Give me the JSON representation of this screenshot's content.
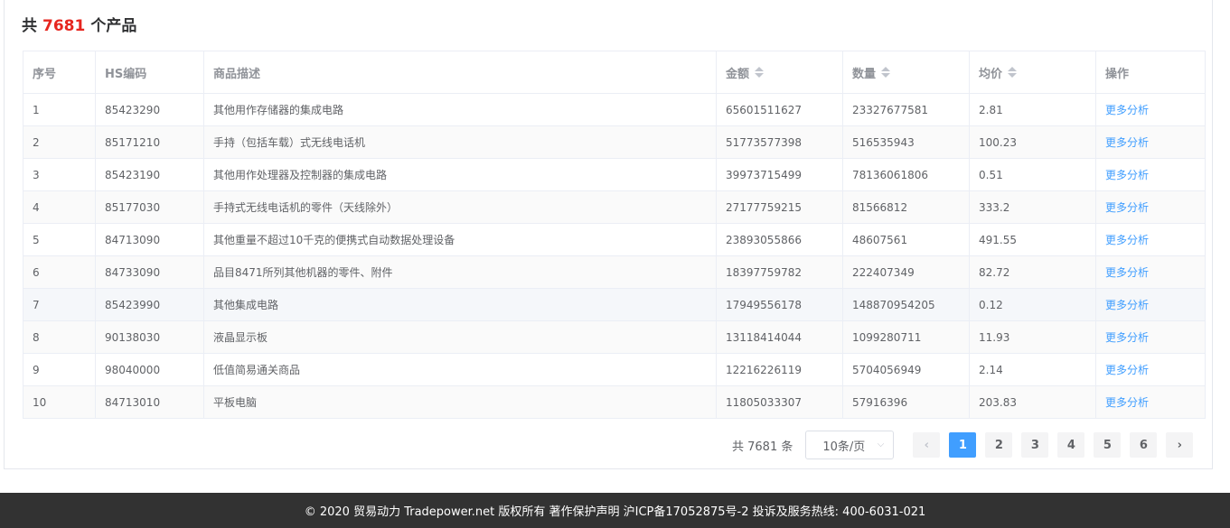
{
  "header": {
    "prefix": "共",
    "count": "7681",
    "suffix": "个产品"
  },
  "table": {
    "columns": [
      "序号",
      "HS编码",
      "商品描述",
      "金额",
      "数量",
      "均价",
      "操作"
    ],
    "rows": [
      {
        "idx": "1",
        "hs": "85423290",
        "desc": "其他用作存储器的集成电路",
        "amount": "65601511627",
        "qty": "23327677581",
        "avg": "2.81",
        "action": "更多分析"
      },
      {
        "idx": "2",
        "hs": "85171210",
        "desc": "手持（包括车载）式无线电话机",
        "amount": "51773577398",
        "qty": "516535943",
        "avg": "100.23",
        "action": "更多分析"
      },
      {
        "idx": "3",
        "hs": "85423190",
        "desc": "其他用作处理器及控制器的集成电路",
        "amount": "39973715499",
        "qty": "78136061806",
        "avg": "0.51",
        "action": "更多分析"
      },
      {
        "idx": "4",
        "hs": "85177030",
        "desc": "手持式无线电话机的零件（天线除外）",
        "amount": "27177759215",
        "qty": "81566812",
        "avg": "333.2",
        "action": "更多分析"
      },
      {
        "idx": "5",
        "hs": "84713090",
        "desc": "其他重量不超过10千克的便携式自动数据处理设备",
        "amount": "23893055866",
        "qty": "48607561",
        "avg": "491.55",
        "action": "更多分析"
      },
      {
        "idx": "6",
        "hs": "84733090",
        "desc": "品目8471所列其他机器的零件、附件",
        "amount": "18397759782",
        "qty": "222407349",
        "avg": "82.72",
        "action": "更多分析"
      },
      {
        "idx": "7",
        "hs": "85423990",
        "desc": "其他集成电路",
        "amount": "17949556178",
        "qty": "148870954205",
        "avg": "0.12",
        "action": "更多分析"
      },
      {
        "idx": "8",
        "hs": "90138030",
        "desc": "液晶显示板",
        "amount": "13118414044",
        "qty": "1099280711",
        "avg": "11.93",
        "action": "更多分析"
      },
      {
        "idx": "9",
        "hs": "98040000",
        "desc": "低值简易通关商品",
        "amount": "12216226119",
        "qty": "5704056949",
        "avg": "2.14",
        "action": "更多分析"
      },
      {
        "idx": "10",
        "hs": "84713010",
        "desc": "平板电脑",
        "amount": "11805033307",
        "qty": "57916396",
        "avg": "203.83",
        "action": "更多分析"
      }
    ]
  },
  "pagination": {
    "total": "共 7681 条",
    "page_size": "10条/页",
    "pages": [
      "1",
      "2",
      "3",
      "4",
      "5",
      "6"
    ],
    "current": "1",
    "prev": "‹",
    "next": "›",
    "dropdown": "⌵"
  },
  "footer": {
    "text": "© 2020 贸易动力 Tradepower.net 版权所有 著作保护声明 沪ICP备17052875号-2 投诉及服务热线: 400-6031-021"
  },
  "colors": {
    "accent": "#409eff",
    "count_red": "#e6261f",
    "footer_bg": "#323232"
  }
}
